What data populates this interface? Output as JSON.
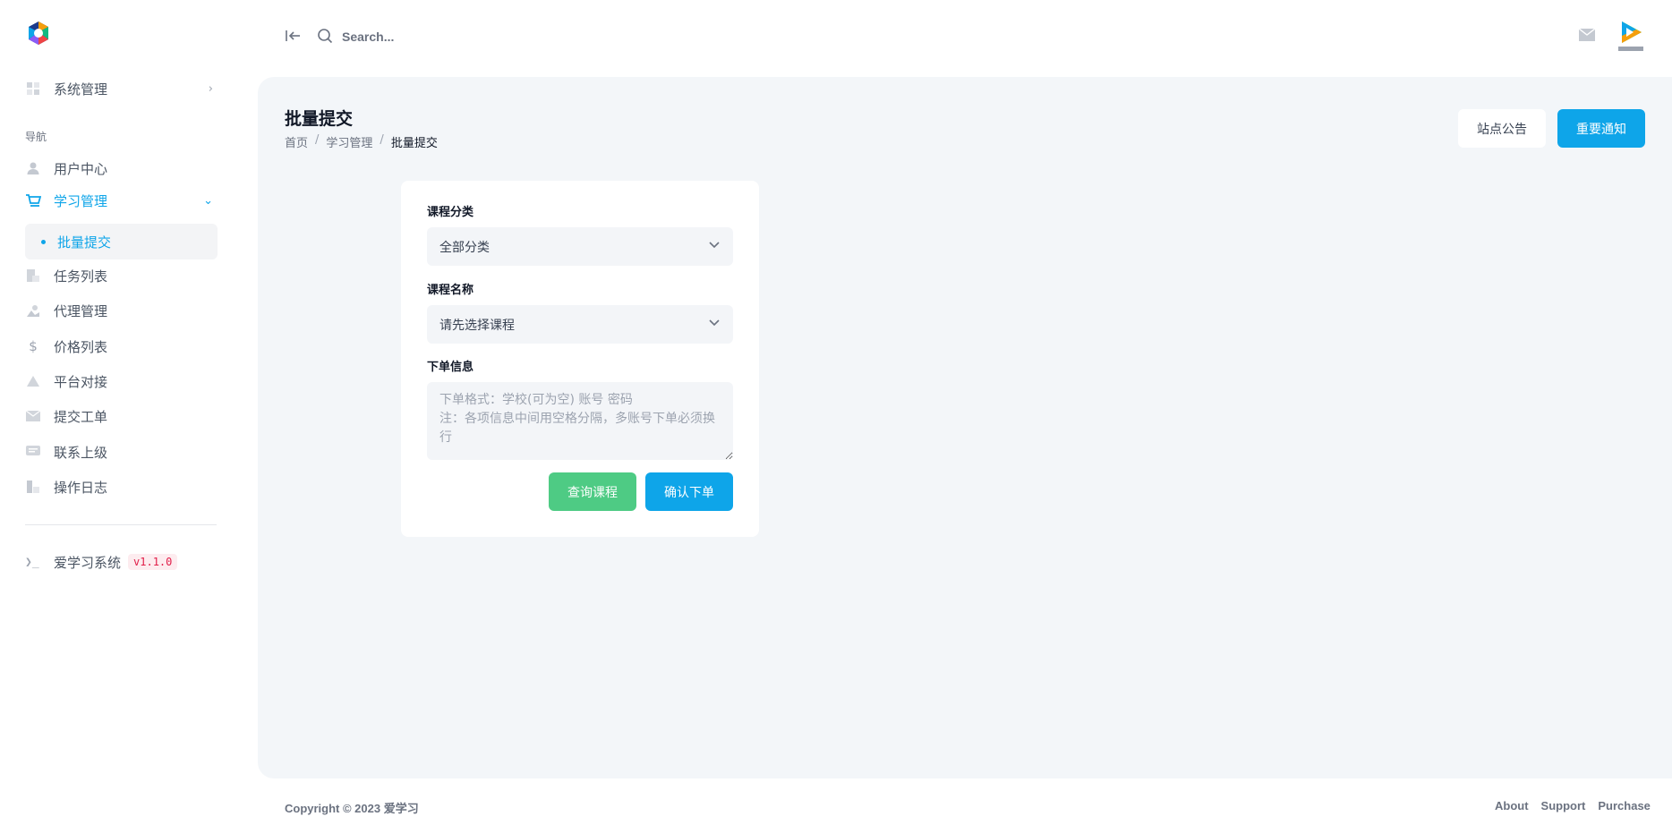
{
  "sidebar": {
    "system_menu": "系统管理",
    "nav_heading": "导航",
    "items": [
      {
        "label": "用户中心",
        "icon": "user-icon"
      },
      {
        "label": "学习管理",
        "icon": "cart-icon"
      },
      {
        "label": "任务列表",
        "icon": "task-icon"
      },
      {
        "label": "代理管理",
        "icon": "agent-icon"
      },
      {
        "label": "价格列表",
        "icon": "dollar-icon"
      },
      {
        "label": "平台对接",
        "icon": "triangle-icon"
      },
      {
        "label": "提交工单",
        "icon": "mail-icon"
      },
      {
        "label": "联系上级",
        "icon": "message-icon"
      },
      {
        "label": "操作日志",
        "icon": "log-icon"
      }
    ],
    "active_sub": "批量提交",
    "app_name": "爱学习系统",
    "version": "v1.1.0",
    "accent_color": "#0ea5e9"
  },
  "topbar": {
    "search_placeholder": "Search..."
  },
  "page": {
    "title": "批量提交",
    "breadcrumb": [
      "首页",
      "学习管理",
      "批量提交"
    ],
    "breadcrumb_sep": "/",
    "announce_label": "站点公告",
    "notice_label": "重要通知"
  },
  "form": {
    "category_label": "课程分类",
    "category_value": "全部分类",
    "course_label": "课程名称",
    "course_value": "请先选择课程",
    "order_label": "下单信息",
    "order_placeholder": "下单格式：学校(可为空) 账号 密码\n注：各项信息中间用空格分隔，多账号下单必须换行",
    "query_label": "查询课程",
    "confirm_label": "确认下单",
    "query_color": "#4ecb84",
    "confirm_color": "#0ea5e9"
  },
  "footer": {
    "copyright": "Copyright © 2023 爱学习",
    "links": [
      "About",
      "Support",
      "Purchase"
    ]
  }
}
